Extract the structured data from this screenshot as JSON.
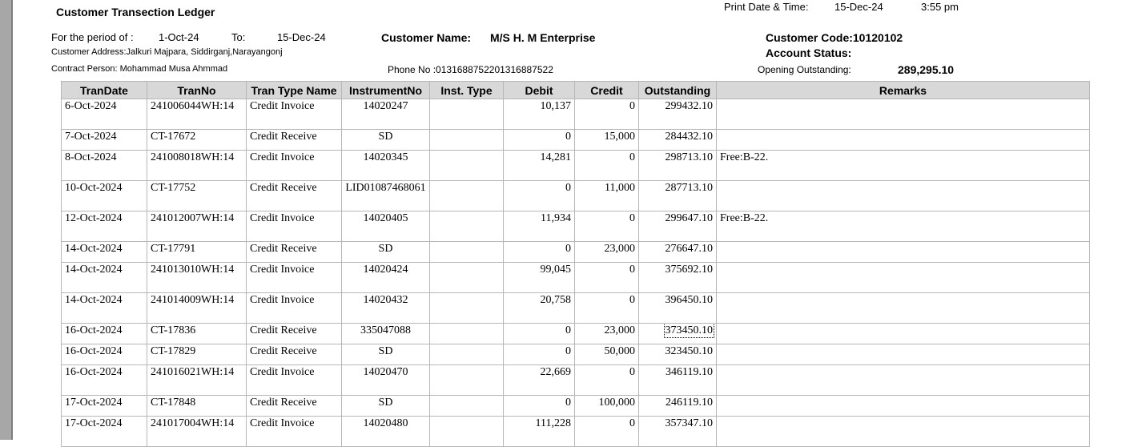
{
  "report": {
    "title": "Customer Transection Ledger",
    "print_label": "Print Date & Time:",
    "print_date": "15-Dec-24",
    "print_time": "3:55 pm",
    "period_label": "For the period of :",
    "period_from": "1-Oct-24",
    "period_to_label": "To:",
    "period_to": "15-Dec-24",
    "customer_name_label": "Customer Name:",
    "customer_name": "M/S H. M Enterprise",
    "customer_code": "Customer Code:10120102",
    "customer_address": "Customer Address:Jalkuri Majpara, Siddirganj,Narayangonj",
    "account_status": "Account Status:",
    "contact_person": "Contract Person: Mohammad Musa Ahmmad",
    "phone": "Phone No :013168875220131688752​2",
    "opening_label": "Opening Outstanding:",
    "opening_value": "289,295.10"
  },
  "table": {
    "headers": [
      "TranDate",
      "TranNo",
      "Tran Type Name",
      "InstrumentNo",
      "Inst. Type",
      "Debit",
      "Credit",
      "Outstanding",
      "Remarks"
    ],
    "rows": [
      [
        "6-Oct-2024",
        "241006044WH:14",
        "Credit Invoice",
        "14020247",
        "",
        "10,137",
        "0",
        "299432.10",
        ""
      ],
      [
        "7-Oct-2024",
        "CT-17672",
        "Credit Receive",
        "SD",
        "",
        "0",
        "15,000",
        "284432.10",
        ""
      ],
      [
        "8-Oct-2024",
        "241008018WH:14",
        "Credit Invoice",
        "14020345",
        "",
        "14,281",
        "0",
        "298713.10",
        "Free:B-22."
      ],
      [
        "10-Oct-2024",
        "CT-17752",
        "Credit Receive",
        "LID01087468061",
        "",
        "0",
        "11,000",
        "287713.10",
        ""
      ],
      [
        "12-Oct-2024",
        "241012007WH:14",
        "Credit Invoice",
        "14020405",
        "",
        "11,934",
        "0",
        "299647.10",
        "Free:B-22."
      ],
      [
        "14-Oct-2024",
        "CT-17791",
        "Credit Receive",
        "SD",
        "",
        "0",
        "23,000",
        "276647.10",
        ""
      ],
      [
        "14-Oct-2024",
        "241013010WH:14",
        "Credit Invoice",
        "14020424",
        "",
        "99,045",
        "0",
        "375692.10",
        ""
      ],
      [
        "14-Oct-2024",
        "241014009WH:14",
        "Credit Invoice",
        "14020432",
        "",
        "20,758",
        "0",
        "396450.10",
        ""
      ],
      [
        "16-Oct-2024",
        "CT-17836",
        "Credit Receive",
        "335047088",
        "",
        "0",
        "23,000",
        "373450.10",
        ""
      ],
      [
        "16-Oct-2024",
        "CT-17829",
        "Credit Receive",
        "SD",
        "",
        "0",
        "50,000",
        "323450.10",
        ""
      ],
      [
        "16-Oct-2024",
        "241016021WH:14",
        "Credit Invoice",
        "14020470",
        "",
        "22,669",
        "0",
        "346119.10",
        ""
      ],
      [
        "17-Oct-2024",
        "CT-17848",
        "Credit Receive",
        "SD",
        "",
        "0",
        "100,000",
        "246119.10",
        ""
      ],
      [
        "17-Oct-2024",
        "241017004WH:14",
        "Credit Invoice",
        "14020480",
        "",
        "111,228",
        "0",
        "357347.10",
        ""
      ]
    ]
  }
}
